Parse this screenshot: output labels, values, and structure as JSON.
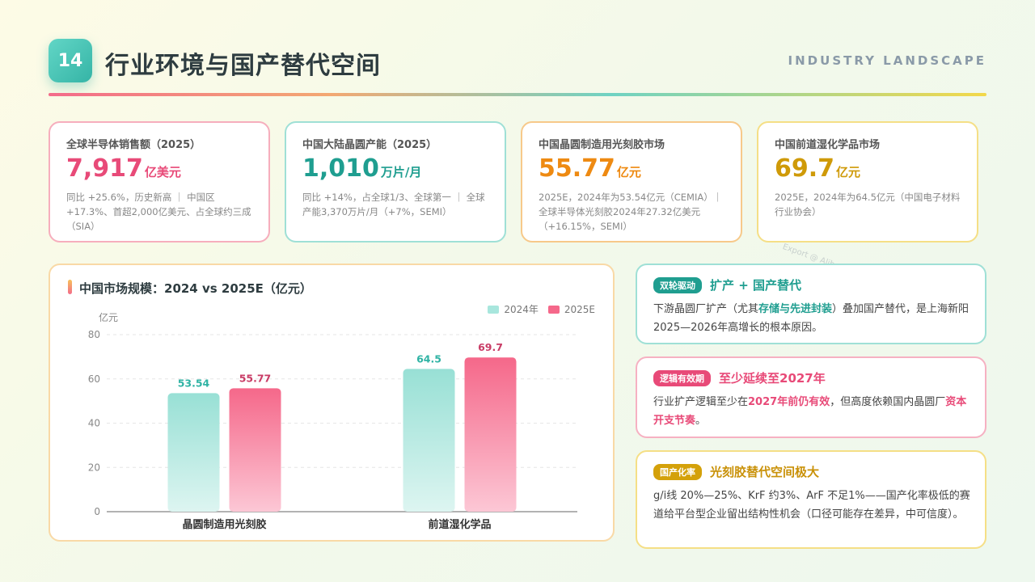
{
  "header": {
    "number": "14",
    "title": "行业环境与国产替代空间",
    "subtitle": "INDUSTRY LANDSCAPE"
  },
  "kpis": [
    {
      "label": "全球半导体销售额（2025）",
      "value": "7,917",
      "unit": "亿美元",
      "note": "同比 +25.6%，历史新高 ｜ 中国区 +17.3%、首超2,000亿美元、占全球约三成（SIA）",
      "color": "#e84a78"
    },
    {
      "label": "中国大陆晶圆产能（2025）",
      "value": "1,010",
      "unit": "万片/月",
      "note": "同比 +14%，占全球1/3、全球第一 ｜ 全球产能3,370万片/月（+7%，SEMI）",
      "color": "#1f9e90"
    },
    {
      "label": "中国晶圆制造用光刻胶市场",
      "value": "55.77",
      "unit": "亿元",
      "note": "2025E，2024年为53.54亿元（CEMIA）｜ 全球半导体光刻胶2024年27.32亿美元（+16.15%，SEMI）",
      "color": "#ee8a12"
    },
    {
      "label": "中国前道湿化学品市场",
      "value": "69.7",
      "unit": "亿元",
      "note": "2025E，2024年为64.5亿元（中国电子材料行业协会）",
      "color": "#cf9a08"
    }
  ],
  "watermark": "Export @ AlibabaSlide.com",
  "chart_panel": {
    "title": "中国市场规模：2024 vs 2025E（亿元）"
  },
  "chart_data": {
    "type": "bar",
    "title": "中国市场规模：2024 vs 2025E（亿元）",
    "ylabel": "亿元",
    "categories": [
      "晶圆制造用光刻胶",
      "前道湿化学品"
    ],
    "series": [
      {
        "name": "2024年",
        "values": [
          53.54,
          64.5
        ],
        "color": "#8fded3"
      },
      {
        "name": "2025E",
        "values": [
          55.77,
          69.7
        ],
        "color": "#f5688a"
      }
    ],
    "data_labels": [
      [
        "53.54",
        "64.5"
      ],
      [
        "55.77",
        "69.7"
      ]
    ],
    "ylim": [
      0,
      80
    ],
    "yticks": [
      0,
      20,
      40,
      60,
      80
    ],
    "grid": true,
    "legend": "top-right"
  },
  "side_cards": [
    {
      "tag": "双轮驱动",
      "title": "扩产 + 国产替代",
      "body": [
        {
          "text": "下游晶圆厂扩产（尤其",
          "style": ""
        },
        {
          "text": "存储与先进封装",
          "style": "hl-teal"
        },
        {
          "text": "）叠加国产替代，是上海新阳2025—2026年高增长的根本原因。",
          "style": ""
        }
      ]
    },
    {
      "tag": "逻辑有效期",
      "title": "至少延续至2027年",
      "body": [
        {
          "text": "行业扩产逻辑至少在",
          "style": ""
        },
        {
          "text": "2027年前仍有效",
          "style": "hl-pink"
        },
        {
          "text": "，但高度依赖国内晶圆厂",
          "style": ""
        },
        {
          "text": "资本开支节奏",
          "style": "hl-pink"
        },
        {
          "text": "。",
          "style": ""
        }
      ]
    },
    {
      "tag": "国产化率",
      "title": "光刻胶替代空间极大",
      "body": [
        {
          "text": "g/i线 20%—25%、KrF 约3%、ArF 不足1%——国产化率极低的赛道给平台型企业留出结构性机会（口径可能存在差异，中可信度）。",
          "style": ""
        }
      ]
    }
  ]
}
